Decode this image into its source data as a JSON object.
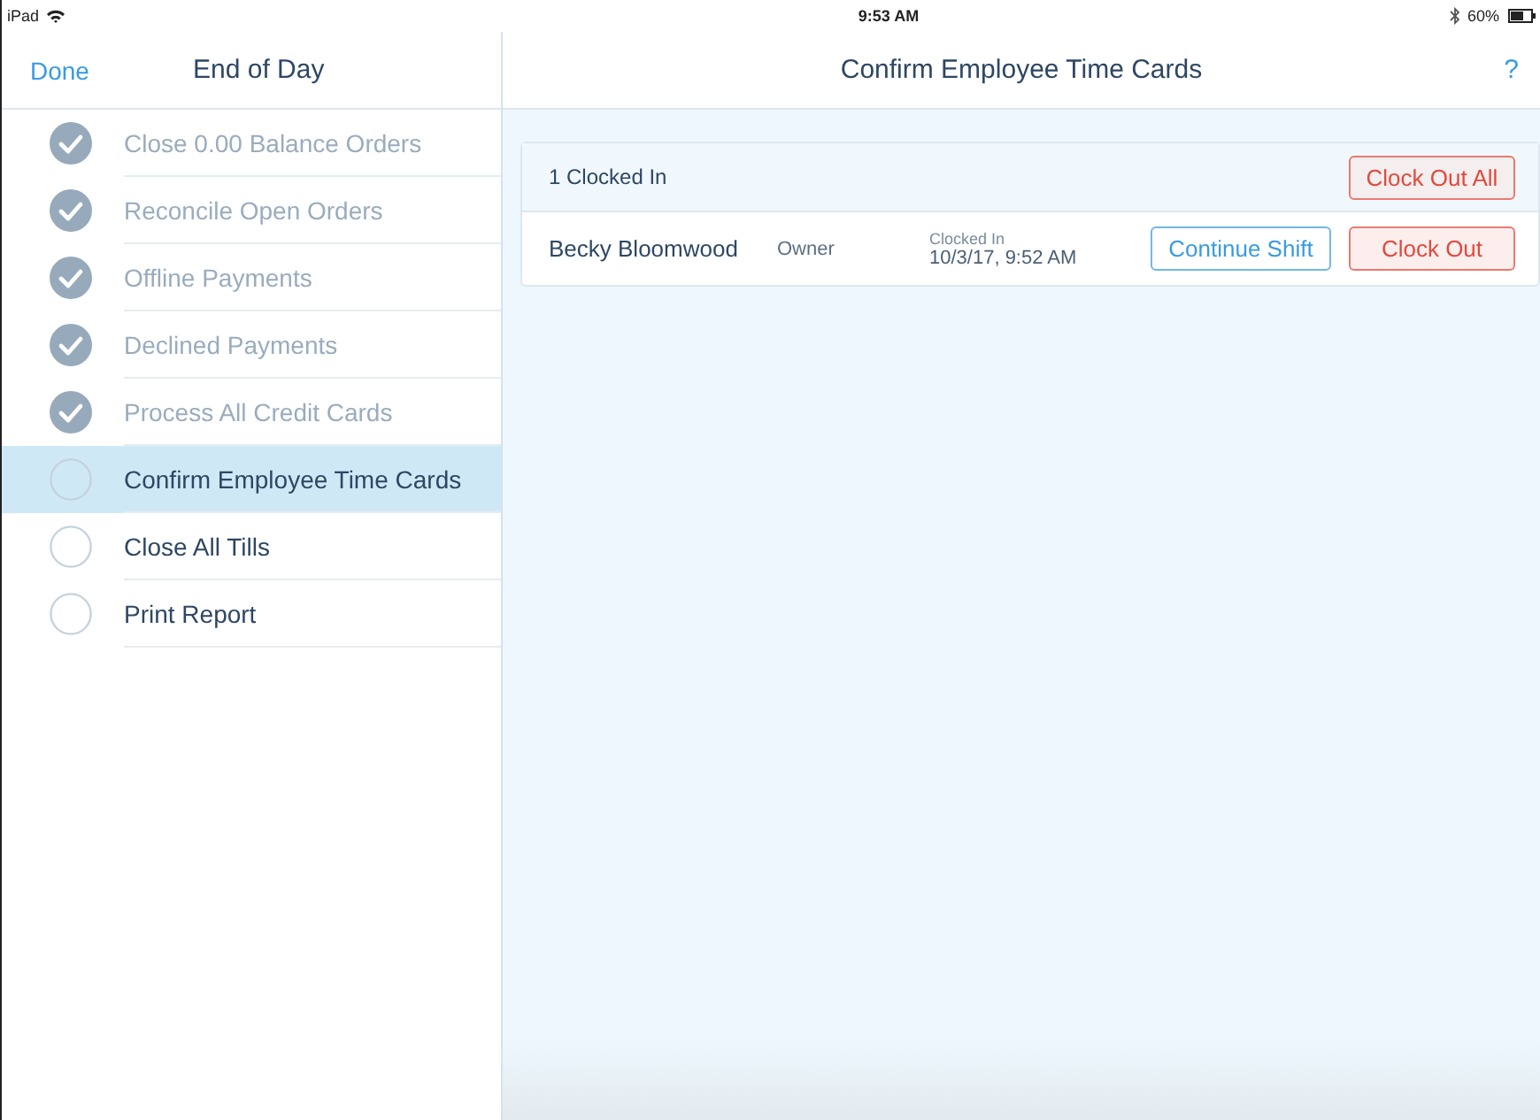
{
  "status_bar": {
    "device": "iPad",
    "time": "9:53 AM",
    "battery": "60%"
  },
  "sidebar": {
    "done_button": "Done",
    "title": "End of Day",
    "steps": [
      {
        "label": "Close 0.00 Balance Orders",
        "checked": true,
        "selected": false
      },
      {
        "label": "Reconcile Open Orders",
        "checked": true,
        "selected": false
      },
      {
        "label": "Offline Payments",
        "checked": true,
        "selected": false
      },
      {
        "label": "Declined Payments",
        "checked": true,
        "selected": false
      },
      {
        "label": "Process All Credit Cards",
        "checked": true,
        "selected": false
      },
      {
        "label": "Confirm Employee Time Cards",
        "checked": false,
        "selected": true
      },
      {
        "label": "Close All Tills",
        "checked": false,
        "selected": false
      },
      {
        "label": "Print Report",
        "checked": false,
        "selected": false
      }
    ]
  },
  "main": {
    "title": "Confirm Employee Time Cards",
    "help_button": "?",
    "summary": "1 Clocked In",
    "clock_out_all_button": "Clock Out All",
    "employees": [
      {
        "name": "Becky Bloomwood",
        "role": "Owner",
        "status_label": "Clocked In",
        "clocked_in_at": "10/3/17, 9:52 AM",
        "continue_button": "Continue Shift",
        "clock_out_button": "Clock Out"
      }
    ]
  }
}
